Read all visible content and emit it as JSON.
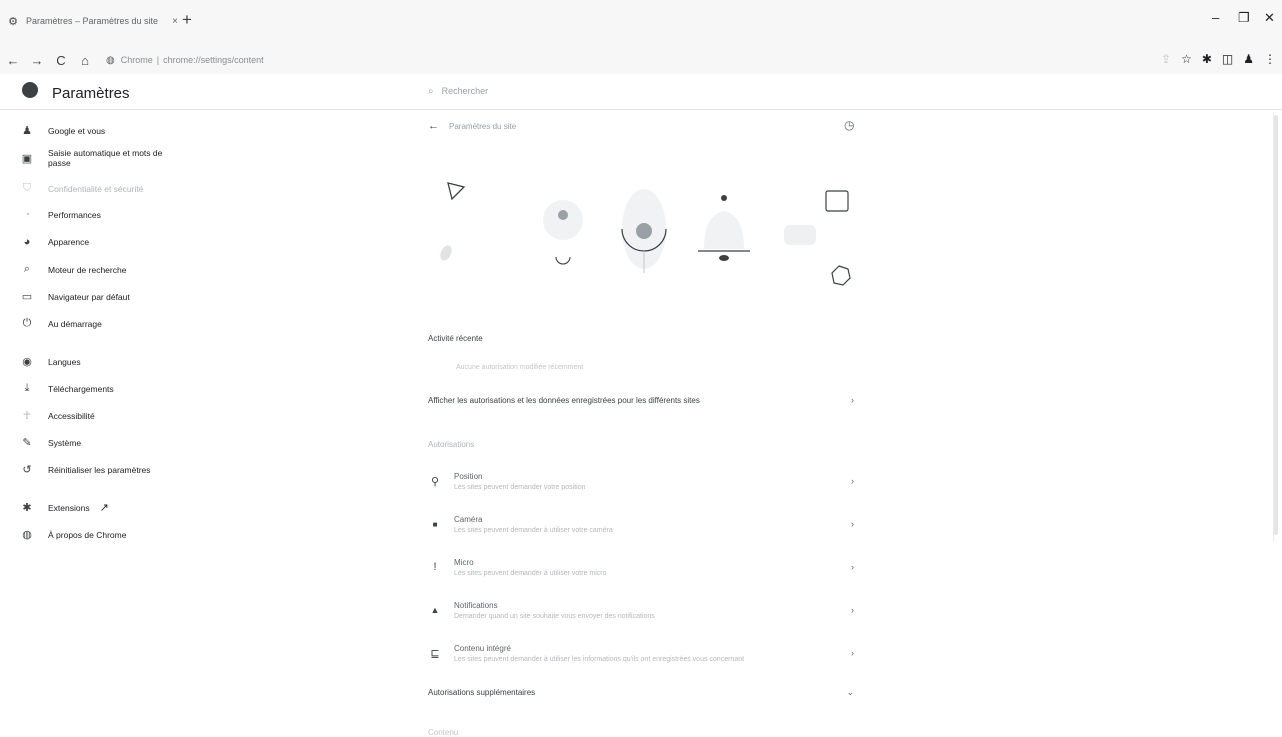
{
  "browser": {
    "tab": {
      "favicon": "gear-icon",
      "title": "Paramètres – Paramètres du site",
      "close": "×"
    },
    "new_tab": "+",
    "window": {
      "minimize": "–",
      "restore": "❐",
      "close": "✕"
    },
    "nav": {
      "back": "←",
      "forward": "→",
      "reload": "C",
      "home": "⌂"
    },
    "omnibox": {
      "site_label": "Chrome",
      "separator": "|",
      "url": "chrome://settings/content"
    },
    "toolbar_icons": {
      "share": "⇪",
      "star": "☆",
      "extensions": "✱",
      "sidepanel": "◫",
      "profile": "♟",
      "menu": "⋮"
    }
  },
  "settings": {
    "title": "Paramètres",
    "search_placeholder": "Rechercher"
  },
  "sidebar": {
    "items": [
      {
        "label": "Google et vous",
        "icon": "person-icon",
        "glyph": "♟"
      },
      {
        "label": "Saisie automatique et mots de passe",
        "icon": "clipboard-icon",
        "glyph": "▣"
      },
      {
        "label": "Confidentialité et sécurité",
        "icon": "shield-icon",
        "glyph": "⛉"
      },
      {
        "label": "Performances",
        "icon": "speedometer-icon",
        "glyph": "◔"
      },
      {
        "label": "Apparence",
        "icon": "palette-icon",
        "glyph": "◕"
      },
      {
        "label": "Moteur de recherche",
        "icon": "search-icon",
        "glyph": "⌕"
      },
      {
        "label": "Navigateur par défaut",
        "icon": "browser-icon",
        "glyph": "▭"
      },
      {
        "label": "Au démarrage",
        "icon": "power-icon",
        "glyph": "⏻"
      },
      {
        "label": "Langues",
        "icon": "globe-icon",
        "glyph": "◉"
      },
      {
        "label": "Téléchargements",
        "icon": "download-icon",
        "glyph": "⤓"
      },
      {
        "label": "Accessibilité",
        "icon": "accessibility-icon",
        "glyph": "☥"
      },
      {
        "label": "Système",
        "icon": "wrench-icon",
        "glyph": "✎"
      },
      {
        "label": "Réinitialiser les paramètres",
        "icon": "reset-icon",
        "glyph": "↺"
      },
      {
        "label": "Extensions",
        "icon": "puzzle-icon",
        "glyph": "✱",
        "external": "↗"
      },
      {
        "label": "À propos de Chrome",
        "icon": "chrome-icon",
        "glyph": "◍"
      }
    ]
  },
  "main": {
    "back_icon": "←",
    "page_title": "Paramètres du site",
    "help_icon": "◷",
    "recent_activity": {
      "title": "Activité récente",
      "empty": "Aucune autorisation modifiée récemment"
    },
    "all_sites": {
      "label": "Afficher les autorisations et les données enregistrées pour les différents sites",
      "chevron": "›"
    },
    "permissions": {
      "title": "Autorisations",
      "items": [
        {
          "title": "Position",
          "subtitle": "Les sites peuvent demander votre position",
          "icon": "location-icon",
          "glyph": "⚲",
          "chevron": "›"
        },
        {
          "title": "Caméra",
          "subtitle": "Les sites peuvent demander à utiliser votre caméra",
          "icon": "camera-icon",
          "glyph": "■",
          "chevron": "›"
        },
        {
          "title": "Micro",
          "subtitle": "Les sites peuvent demander à utiliser votre micro",
          "icon": "microphone-icon",
          "glyph": "!",
          "chevron": "›"
        },
        {
          "title": "Notifications",
          "subtitle": "Demander quand un site souhaite vous envoyer des notifications",
          "icon": "bell-icon",
          "glyph": "▲",
          "chevron": "›"
        },
        {
          "title": "Contenu intégré",
          "subtitle": "Les sites peuvent demander à utiliser les informations qu'ils ont enregistrées vous concernant",
          "icon": "embedded-content-icon",
          "glyph": "⊑",
          "chevron": "›"
        }
      ]
    },
    "additional": {
      "label": "Autorisations supplémentaires",
      "chevron": "⌄"
    },
    "content_title": "Contenu"
  }
}
